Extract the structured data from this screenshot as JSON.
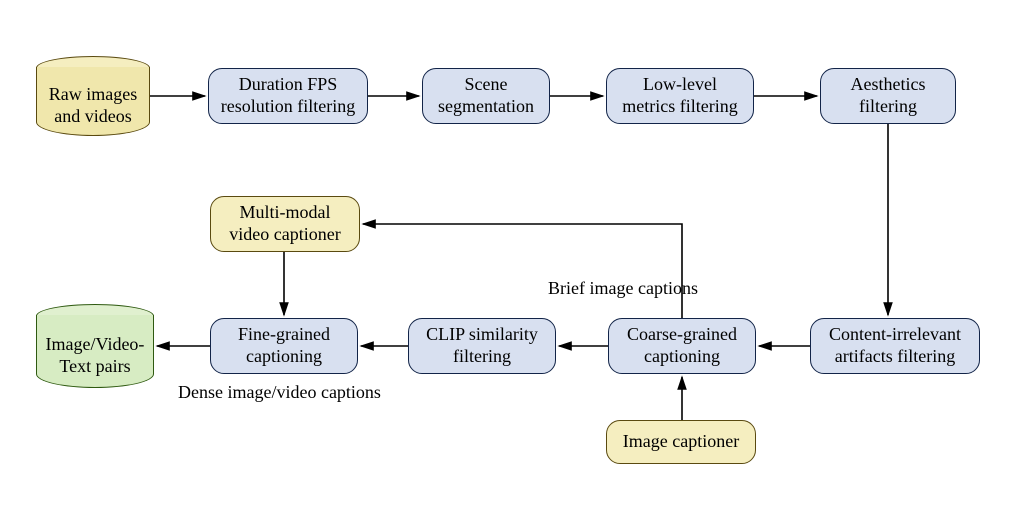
{
  "diagram": {
    "type": "flowchart",
    "nodes": {
      "raw": {
        "label": "Raw images\nand videos",
        "shape": "cylinder",
        "color": "yellow"
      },
      "duration": {
        "label": "Duration FPS\nresolution filtering",
        "shape": "rounded",
        "color": "blue"
      },
      "scene": {
        "label": "Scene\nsegmentation",
        "shape": "rounded",
        "color": "blue"
      },
      "lowlevel": {
        "label": "Low-level\nmetrics filtering",
        "shape": "rounded",
        "color": "blue"
      },
      "aesth": {
        "label": "Aesthetics\nfiltering",
        "shape": "rounded",
        "color": "blue"
      },
      "content": {
        "label": "Content-irrelevant\nartifacts filtering",
        "shape": "rounded",
        "color": "blue"
      },
      "coarse": {
        "label": "Coarse-grained\ncaptioning",
        "shape": "rounded",
        "color": "blue"
      },
      "clip": {
        "label": "CLIP similarity\nfiltering",
        "shape": "rounded",
        "color": "blue"
      },
      "fine": {
        "label": "Fine-grained\ncaptioning",
        "shape": "rounded",
        "color": "blue"
      },
      "multimodal": {
        "label": "Multi-modal\nvideo captioner",
        "shape": "rounded",
        "color": "yellow"
      },
      "imgcap": {
        "label": "Image captioner",
        "shape": "rounded",
        "color": "yellow"
      },
      "output": {
        "label": "Image/Video-\nText pairs",
        "shape": "cylinder",
        "color": "green"
      }
    },
    "edges": [
      {
        "from": "raw",
        "to": "duration"
      },
      {
        "from": "duration",
        "to": "scene"
      },
      {
        "from": "scene",
        "to": "lowlevel"
      },
      {
        "from": "lowlevel",
        "to": "aesth"
      },
      {
        "from": "aesth",
        "to": "content"
      },
      {
        "from": "content",
        "to": "coarse"
      },
      {
        "from": "coarse",
        "to": "clip"
      },
      {
        "from": "clip",
        "to": "fine"
      },
      {
        "from": "fine",
        "to": "output"
      },
      {
        "from": "coarse",
        "to": "multimodal",
        "label": "Brief image captions"
      },
      {
        "from": "multimodal",
        "to": "fine"
      },
      {
        "from": "imgcap",
        "to": "coarse"
      }
    ],
    "edge_labels": {
      "brief": "Brief image captions",
      "dense": "Dense image/video captions"
    }
  }
}
